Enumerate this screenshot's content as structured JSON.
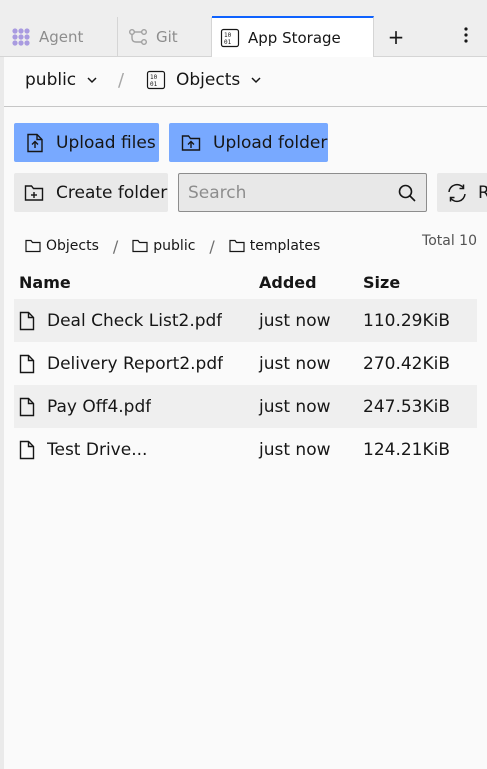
{
  "tabs": [
    {
      "label": "Agent",
      "icon": "agent-icon",
      "active": false
    },
    {
      "label": "Git",
      "icon": "git-icon",
      "active": false
    },
    {
      "label": "App Storage",
      "icon": "binary-storage-icon",
      "active": true
    }
  ],
  "tab_actions": {
    "add": "+"
  },
  "header": {
    "bucket": "public",
    "separator": "/",
    "view": "Objects"
  },
  "actions": {
    "upload_files": "Upload files",
    "upload_folder": "Upload folder",
    "create_folder": "Create folder",
    "search_placeholder": "Search",
    "refresh": "Refresh"
  },
  "breadcrumb": [
    {
      "label": "Objects"
    },
    {
      "label": "public"
    },
    {
      "label": "templates"
    }
  ],
  "breadcrumb_sep": "/",
  "total": "Total 10",
  "table": {
    "columns": [
      "Name",
      "Added",
      "Size"
    ],
    "rows": [
      {
        "name": "Deal Check List2.pdf",
        "added": "just now",
        "size": "110.29KiB"
      },
      {
        "name": "Delivery Report2.pdf",
        "added": "just now",
        "size": "270.42KiB"
      },
      {
        "name": "Pay Off4.pdf",
        "added": "just now",
        "size": "247.53KiB"
      },
      {
        "name": "Test Drive...",
        "added": "just now",
        "size": "124.21KiB"
      }
    ]
  },
  "colors": {
    "accent": "#0f62fe",
    "primary_button": "#78a9ff",
    "secondary_button": "#e9e9e9"
  }
}
